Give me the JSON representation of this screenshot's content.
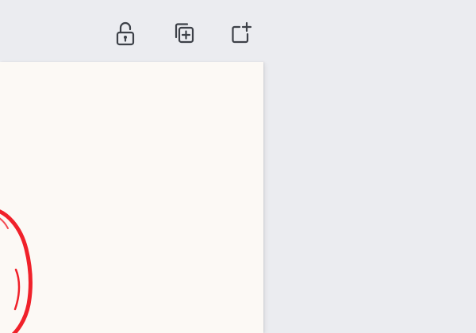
{
  "colors": {
    "workspace_background": "#EBECF0",
    "page_background": "#FCF9F5",
    "icon_stroke": "#3D4148",
    "drawing_stroke": "#F0212A"
  },
  "page_toolbar": {
    "buttons": [
      {
        "name": "lock-page-button",
        "icon": "unlock-icon"
      },
      {
        "name": "duplicate-page-button",
        "icon": "duplicate-page-icon"
      },
      {
        "name": "add-page-button",
        "icon": "add-page-icon"
      }
    ]
  },
  "canvas": {
    "elements": [
      {
        "type": "freehand-drawing",
        "shape": "oval outline partially visible at left edge",
        "color": "#F0212A"
      }
    ]
  }
}
